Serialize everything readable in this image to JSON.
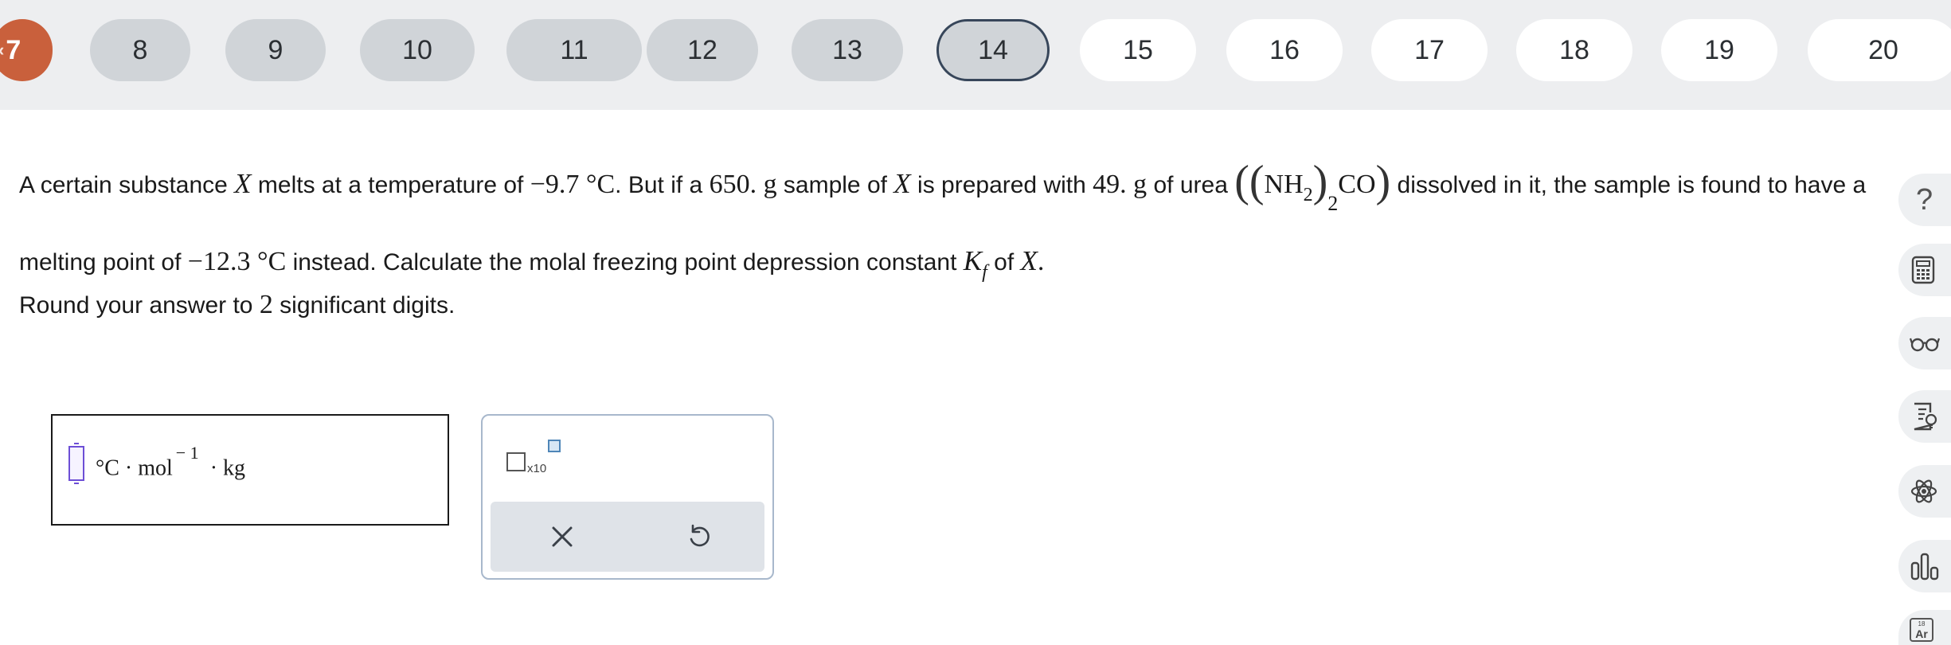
{
  "nav": {
    "prev": {
      "label": "7",
      "icon": "chevron-left-icon",
      "color": "#c9603c"
    },
    "items": [
      {
        "label": "8",
        "state": "done"
      },
      {
        "label": "9",
        "state": "done"
      },
      {
        "label": "10",
        "state": "done"
      },
      {
        "label": "11",
        "state": "done"
      },
      {
        "label": "12",
        "state": "done"
      },
      {
        "label": "13",
        "state": "done"
      },
      {
        "label": "14",
        "state": "current"
      },
      {
        "label": "15",
        "state": "todo"
      },
      {
        "label": "16",
        "state": "todo"
      },
      {
        "label": "17",
        "state": "todo"
      },
      {
        "label": "18",
        "state": "todo"
      },
      {
        "label": "19",
        "state": "todo"
      },
      {
        "label": "20",
        "state": "todo"
      }
    ]
  },
  "question": {
    "t1": "A certain substance ",
    "X": "X",
    "t2": " melts at a temperature of ",
    "temp1": "−9.7 °C",
    "t3": ". But if a ",
    "mass_sample": "650. g",
    "t4": " sample of ",
    "t5": " is prepared with ",
    "mass_urea": "49. g",
    "t6": " of urea ",
    "formula_nh": "NH",
    "formula_sub2": "2",
    "formula_co": "CO",
    "t7": " dissolved in it, the sample is found to have a melting point of ",
    "temp2": "−12.3 °C",
    "t8": " instead. Calculate the molal freezing point depression constant ",
    "K": "K",
    "K_sub": "f",
    "t9": " of ",
    "t10": ".",
    "round_pre": "Round your answer to ",
    "round_num": "2",
    "round_post": " significant digits."
  },
  "answer": {
    "value": "",
    "unit_main": "°C · mol",
    "unit_exp": "− 1",
    "unit_tail": "· kg"
  },
  "tools": {
    "x10_label": "x10",
    "clear_icon": "close-icon",
    "undo_icon": "undo-icon"
  },
  "sidebar": {
    "help_label": "?",
    "items": [
      "help-icon",
      "calculator-icon",
      "glasses-icon",
      "reference-icon",
      "atom-icon",
      "bar-chart-icon",
      "periodic-table-icon"
    ],
    "periodic_num": "18",
    "periodic_sym": "Ar"
  }
}
